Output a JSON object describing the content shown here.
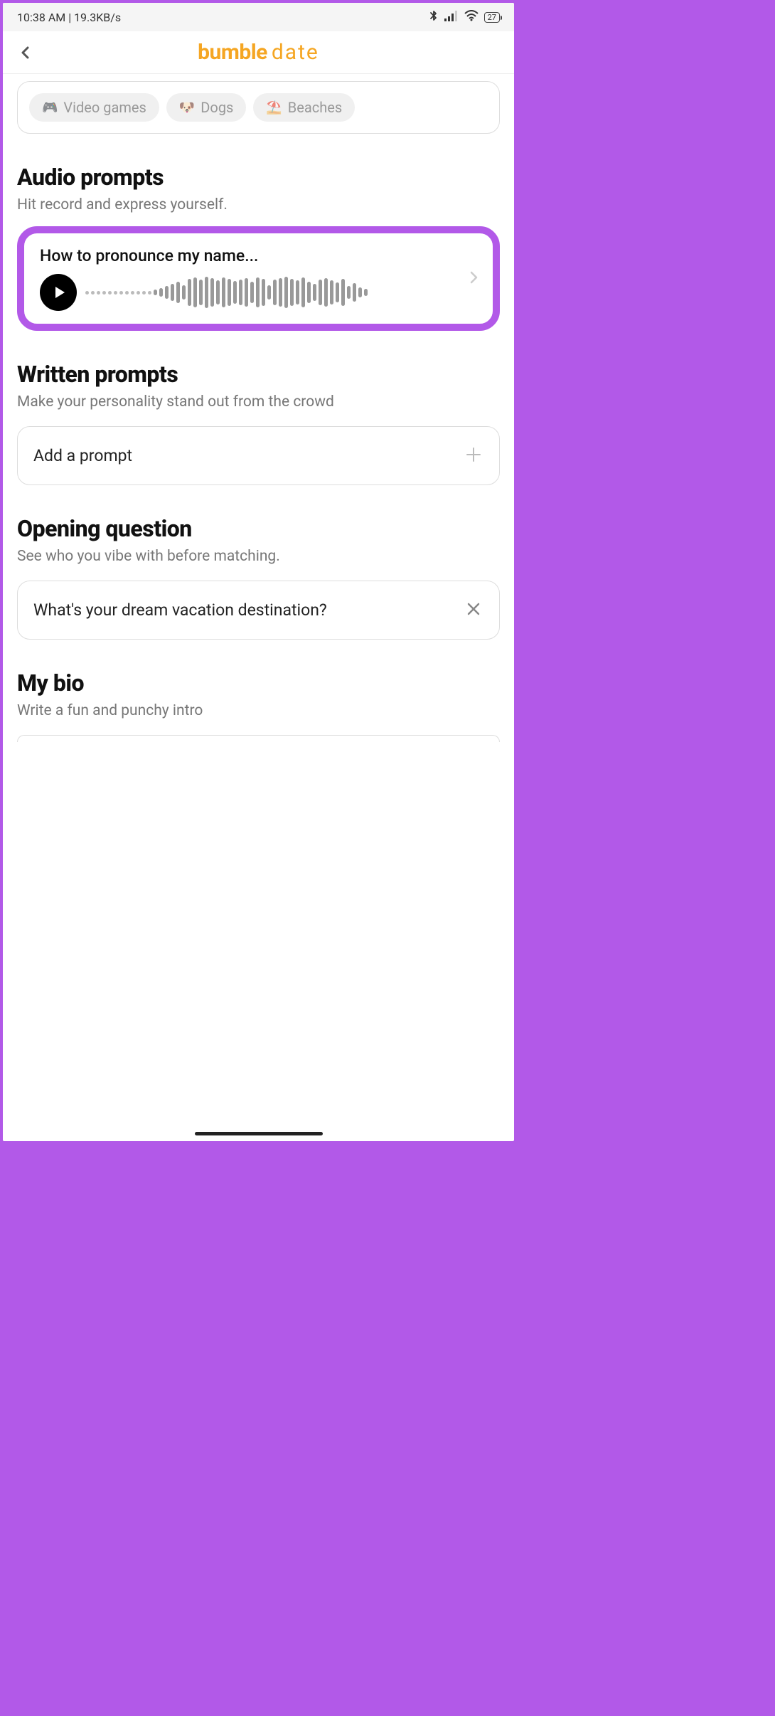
{
  "statusbar": {
    "time_and_speed": "10:38 AM | 19.3KB/s",
    "battery": "27",
    "icons": {
      "bluetooth": "bluetooth",
      "signal": "signal",
      "wifi": "wifi"
    }
  },
  "appbar": {
    "brand_bold": "bumble",
    "brand_light": "date"
  },
  "interests": {
    "items": [
      {
        "emoji": "🎮",
        "label": "Video games"
      },
      {
        "emoji": "🐶",
        "label": "Dogs"
      },
      {
        "emoji": "⛱️",
        "label": "Beaches"
      }
    ]
  },
  "audio_prompts": {
    "title": "Audio prompts",
    "subtitle": "Hit record and express yourself.",
    "item": {
      "label": "How to pronounce my name..."
    }
  },
  "written_prompts": {
    "title": "Written prompts",
    "subtitle": "Make your personality stand out from the crowd",
    "add_label": "Add a prompt"
  },
  "opening_question": {
    "title": "Opening question",
    "subtitle": "See who you vibe with before matching.",
    "question": "What's your dream vacation destination?"
  },
  "bio": {
    "title": "My bio",
    "subtitle": "Write a fun and punchy intro"
  }
}
